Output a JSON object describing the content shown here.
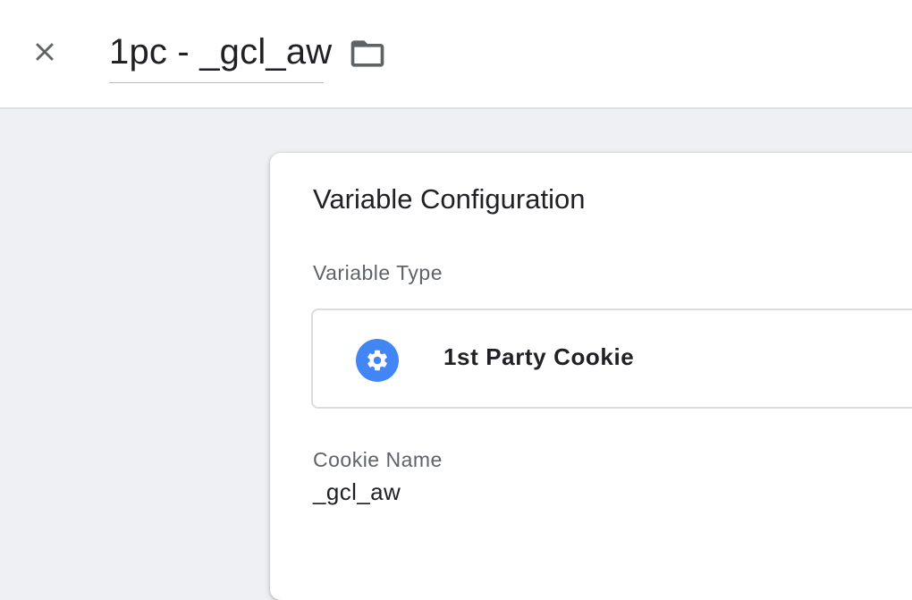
{
  "header": {
    "title": "1pc - _gcl_aw",
    "close_icon": "close-icon",
    "folder_icon": "folder-icon"
  },
  "card": {
    "title": "Variable Configuration",
    "variable_type_label": "Variable Type",
    "variable_type_value": "1st Party Cookie",
    "variable_type_icon": "gear-icon",
    "cookie_name_label": "Cookie Name",
    "cookie_name_value": "_gcl_aw"
  },
  "colors": {
    "accent": "#4285f4",
    "page_background": "#eef0f3",
    "card_background": "#ffffff"
  }
}
